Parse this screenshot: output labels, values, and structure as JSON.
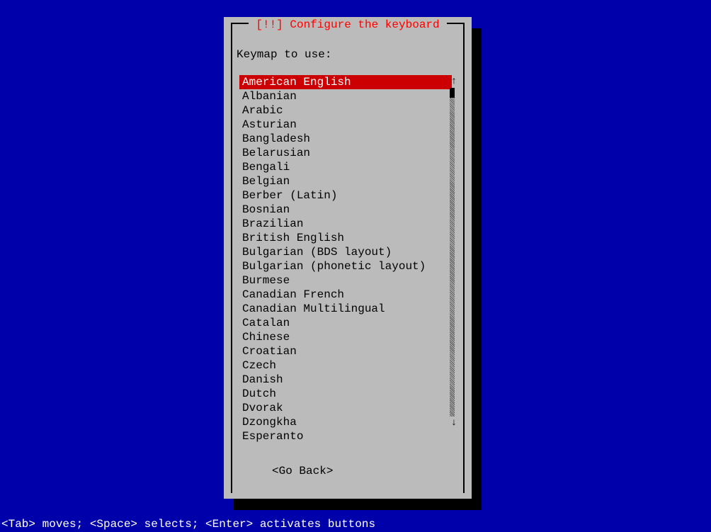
{
  "dialog": {
    "title": "[!!] Configure the keyboard",
    "prompt": "Keymap to use:",
    "selected_index": 0,
    "items": [
      "American English",
      "Albanian",
      "Arabic",
      "Asturian",
      "Bangladesh",
      "Belarusian",
      "Bengali",
      "Belgian",
      "Berber (Latin)",
      "Bosnian",
      "Brazilian",
      "British English",
      "Bulgarian (BDS layout)",
      "Bulgarian (phonetic layout)",
      "Burmese",
      "Canadian French",
      "Canadian Multilingual",
      "Catalan",
      "Chinese",
      "Croatian",
      "Czech",
      "Danish",
      "Dutch",
      "Dvorak",
      "Dzongkha",
      "Esperanto"
    ],
    "go_back": "<Go Back>"
  },
  "scrollbar": {
    "up": "↑",
    "down": "↓"
  },
  "footer": "<Tab> moves; <Space> selects; <Enter> activates buttons"
}
